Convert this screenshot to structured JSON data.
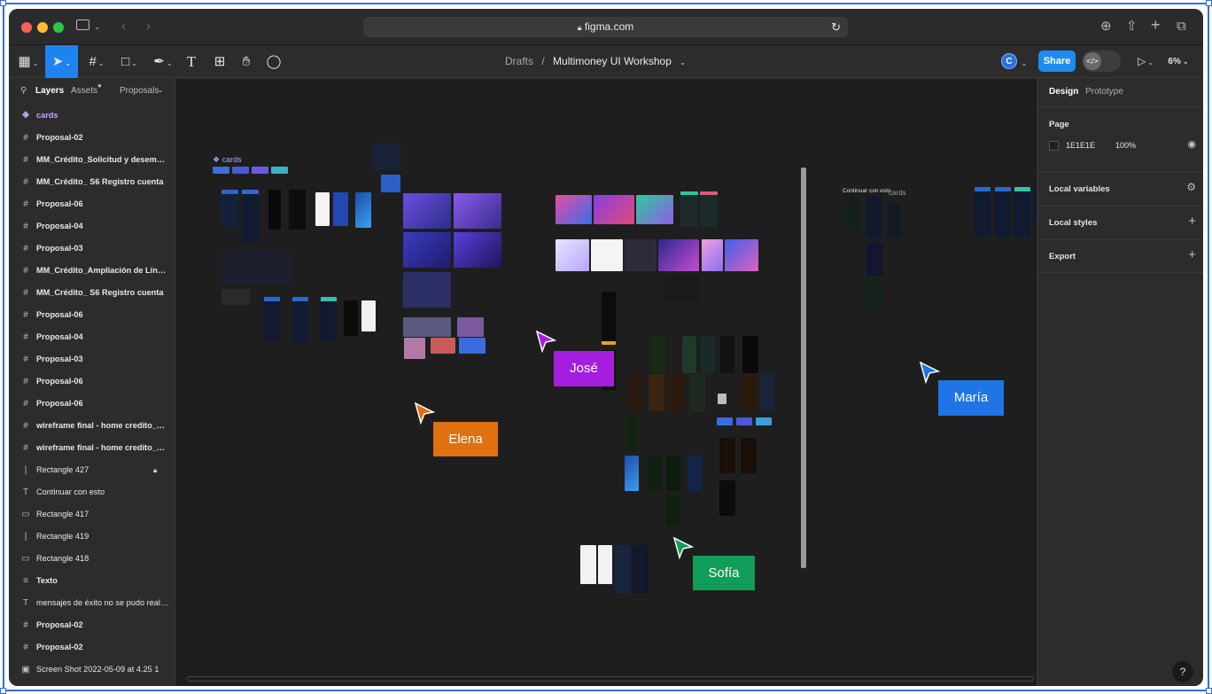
{
  "browser": {
    "url": "figma.com"
  },
  "toolbar": {
    "breadcrumb_parent": "Drafts",
    "breadcrumb_separator": "/",
    "file_name": "Multimoney UI Workshop",
    "avatar_initial": "C",
    "share_label": "Share",
    "zoom": "6%"
  },
  "left_panel": {
    "tabs": [
      "Layers",
      "Assets",
      "Proposals"
    ],
    "layers": [
      {
        "name": "cards",
        "kind": "component"
      },
      {
        "name": "Proposal-02",
        "kind": "frame"
      },
      {
        "name": "MM_Crédito_Solicitud y desembolso",
        "kind": "frame"
      },
      {
        "name": "MM_Crédito_ S6 Registro cuenta",
        "kind": "frame"
      },
      {
        "name": "Proposal-06",
        "kind": "frame"
      },
      {
        "name": "Proposal-04",
        "kind": "frame"
      },
      {
        "name": "Proposal-03",
        "kind": "frame"
      },
      {
        "name": "MM_Crédito_Ampliación de Línea de crédito",
        "kind": "frame"
      },
      {
        "name": "MM_Crédito_ S6 Registro cuenta",
        "kind": "frame"
      },
      {
        "name": "Proposal-06",
        "kind": "frame"
      },
      {
        "name": "Proposal-04",
        "kind": "frame"
      },
      {
        "name": "Proposal-03",
        "kind": "frame"
      },
      {
        "name": "Proposal-06",
        "kind": "frame"
      },
      {
        "name": "Proposal-06",
        "kind": "frame"
      },
      {
        "name": "wireframe final - home credito_Con deuda",
        "kind": "frame"
      },
      {
        "name": "wireframe final - home credito_Con deuda",
        "kind": "frame"
      },
      {
        "name": "Rectangle 427",
        "kind": "line"
      },
      {
        "name": "Continuar con esto",
        "kind": "text"
      },
      {
        "name": "Rectangle 417",
        "kind": "rect"
      },
      {
        "name": "Rectangle 419",
        "kind": "line"
      },
      {
        "name": "Rectangle 418",
        "kind": "rect"
      },
      {
        "name": "Texto",
        "kind": "group"
      },
      {
        "name": "mensajes de éxito no se pudo realizar",
        "kind": "text"
      },
      {
        "name": "Proposal-02",
        "kind": "frame"
      },
      {
        "name": "Proposal-02",
        "kind": "frame"
      },
      {
        "name": "Screen Shot 2022-05-09 at 4.25 1",
        "kind": "image"
      }
    ]
  },
  "canvas": {
    "cards_label": "cards",
    "cards_label_2": "cards",
    "continuar_label": "Continuar con esto",
    "cursors": [
      {
        "name": "José",
        "color": "#a51ee0"
      },
      {
        "name": "Elena",
        "color": "#e07010"
      },
      {
        "name": "María",
        "color": "#1f75e6"
      },
      {
        "name": "Sofía",
        "color": "#109d58"
      }
    ]
  },
  "right_panel": {
    "tabs": [
      "Design",
      "Prototype"
    ],
    "page_title": "Page",
    "page_color": "1E1E1E",
    "page_opacity": "100%",
    "sections": [
      "Local variables",
      "Local styles",
      "Export"
    ]
  },
  "help": "?"
}
